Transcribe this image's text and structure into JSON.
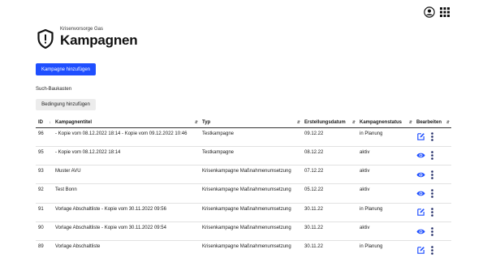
{
  "header": {
    "subtitle": "Krisenvorsorge Gas",
    "title": "Kampagnen"
  },
  "icons": {
    "user": "user-circle-icon",
    "apps": "apps-grid-icon",
    "shield": "shield-alert-icon"
  },
  "colors": {
    "primary": "#1f4fff",
    "icon": "#1f4fff"
  },
  "actions": {
    "add_campaign": "Kampagne hinzufügen",
    "search_label": "Such-Baukasten",
    "add_condition": "Bedingung hinzufügen"
  },
  "table": {
    "columns": [
      "ID",
      "Kampagnentitel",
      "Typ",
      "Erstellungsdatum",
      "Kampagnenstatus",
      "Bearbeiten"
    ],
    "rows": [
      {
        "id": "96",
        "title": "- Kopie vom 08.12.2022 18:14 - Kopie vom 09.12.2022 10:46",
        "type": "Testkampagne",
        "date": "09.12.22",
        "status": "in Planung",
        "action": "edit"
      },
      {
        "id": "95",
        "title": "- Kopie vom 08.12.2022 18:14",
        "type": "Testkampagne",
        "date": "08.12.22",
        "status": "aktiv",
        "action": "view"
      },
      {
        "id": "93",
        "title": "Muster AVU",
        "type": "Krisenkampagne Maßnahmenumsetzung",
        "date": "07.12.22",
        "status": "aktiv",
        "action": "view"
      },
      {
        "id": "92",
        "title": "Test Bonn",
        "type": "Krisenkampagne Maßnahmenumsetzung",
        "date": "05.12.22",
        "status": "aktiv",
        "action": "view"
      },
      {
        "id": "91",
        "title": "Vorlage Abschaltliste - Kopie vom 30.11.2022 09:56",
        "type": "Krisenkampagne Maßnahmenumsetzung",
        "date": "30.11.22",
        "status": "in Planung",
        "action": "edit"
      },
      {
        "id": "90",
        "title": "Vorlage Abschaltliste - Kopie vom 30.11.2022 09:54",
        "type": "Krisenkampagne Maßnahmenumsetzung",
        "date": "30.11.22",
        "status": "aktiv",
        "action": "view"
      },
      {
        "id": "89",
        "title": "Vorlage Abschaltliste",
        "type": "Krisenkampagne Maßnahmenumsetzung",
        "date": "30.11.22",
        "status": "in Planung",
        "action": "edit"
      }
    ]
  }
}
